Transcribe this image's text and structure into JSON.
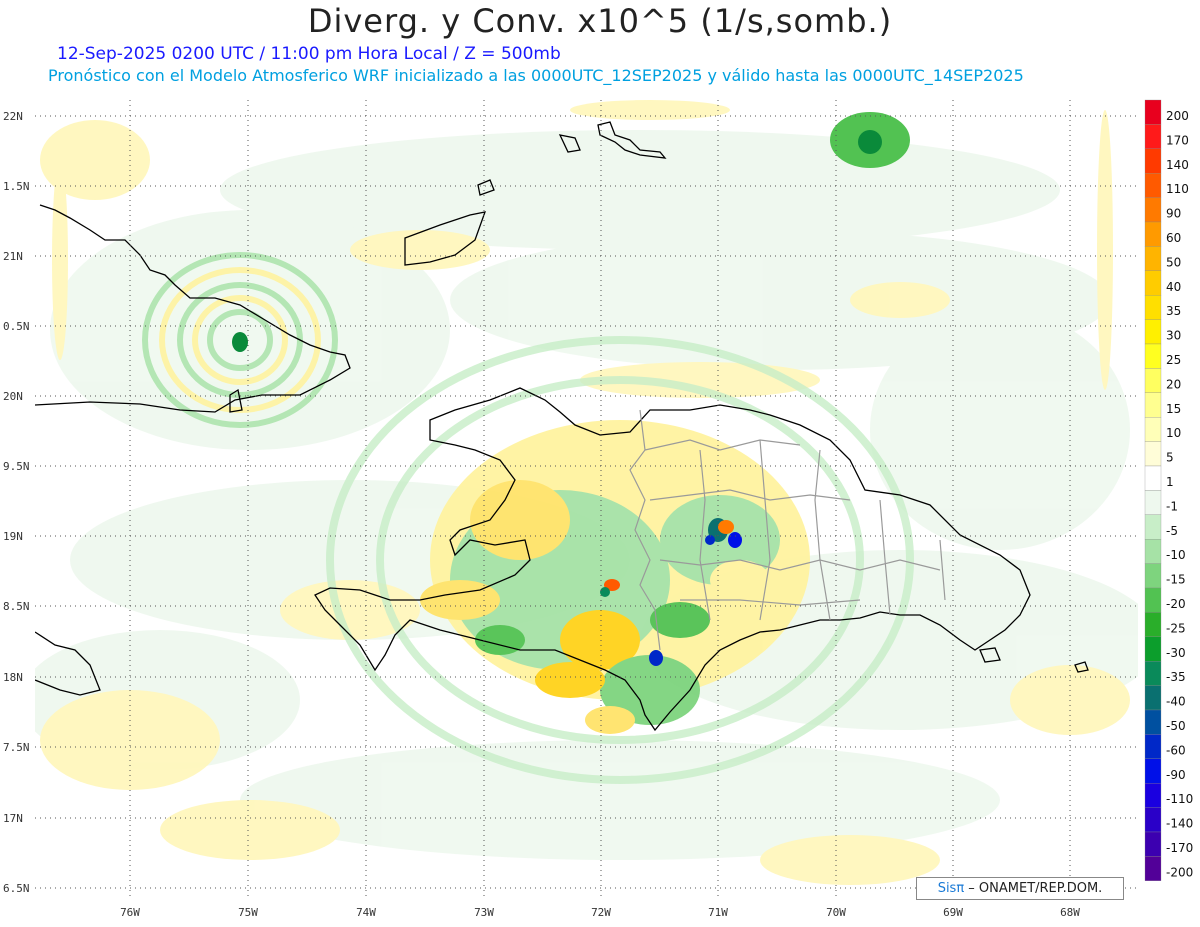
{
  "title": "Diverg. y Conv. x10^5 (1/s,somb.)",
  "subtitle_line1": "12-Sep-2025  0200 UTC / 11:00 pm Hora Local / Z = 500mb",
  "subtitle_line2": "Pronóstico con el Modelo Atmosferico WRF inicializado a las 0000UTC_12SEP2025 y válido hasta las  0000UTC_14SEP2025",
  "map": {
    "lat_labels": [
      "22N",
      "1.5N",
      "21N",
      "0.5N",
      "20N",
      "9.5N",
      "19N",
      "8.5N",
      "18N",
      "7.5N",
      "17N",
      "6.5N"
    ],
    "lon_labels": [
      "76W",
      "75W",
      "74W",
      "73W",
      "72W",
      "71W",
      "70W",
      "69W",
      "68W"
    ],
    "field_colors": {
      "convergence": "#8fd08f",
      "strong_convergence": "#0a8a3a",
      "divergence": "#fff3a0",
      "strong_divergence": "#ffd21a"
    }
  },
  "colorbar": {
    "labels": [
      "200",
      "170",
      "140",
      "110",
      "90",
      "60",
      "50",
      "40",
      "35",
      "30",
      "25",
      "20",
      "15",
      "10",
      "5",
      "1",
      "-1",
      "-5",
      "-10",
      "-15",
      "-20",
      "-25",
      "-30",
      "-35",
      "-40",
      "-50",
      "-60",
      "-90",
      "-110",
      "-140",
      "-170",
      "-200"
    ],
    "colors": [
      "#e8001e",
      "#ff1a1a",
      "#ff3a00",
      "#ff5a00",
      "#ff7a00",
      "#ff9a00",
      "#ffb400",
      "#ffcc00",
      "#ffdf00",
      "#fff000",
      "#ffff20",
      "#ffff60",
      "#ffff90",
      "#ffffb8",
      "#fffdd8",
      "#ffffff",
      "#eef8ee",
      "#c8eec8",
      "#a6e2a6",
      "#7ed47e",
      "#52c252",
      "#2aae2a",
      "#0c9e2c",
      "#0a8a5a",
      "#0a7070",
      "#0050a0",
      "#0028c8",
      "#0010e8",
      "#1a00e0",
      "#2a00c8",
      "#3c00b0",
      "#520098"
    ]
  },
  "credit": {
    "brand": "Sisπ",
    "text": " – ONAMET/REP.DOM."
  }
}
